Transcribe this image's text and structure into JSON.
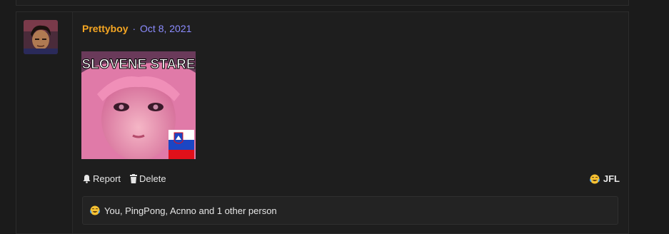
{
  "post": {
    "author": "Prettyboy",
    "separator": "·",
    "date": "Oct 8, 2021",
    "image": {
      "caption": "SLOVENE STARE",
      "icon": "meme-image"
    },
    "actions": {
      "report_label": "Report",
      "delete_label": "Delete"
    },
    "reaction": {
      "emoji_icon": "crying-laughing-icon",
      "label": "JFL"
    },
    "reactions_summary": {
      "emoji_icon": "crying-laughing-icon",
      "text": "You, PingPong, Acnno and 1 other person"
    }
  },
  "colors": {
    "author": "#f5a623",
    "date": "#8c8cff",
    "background": "#1b1b1b",
    "panel": "#1e1e1e"
  }
}
